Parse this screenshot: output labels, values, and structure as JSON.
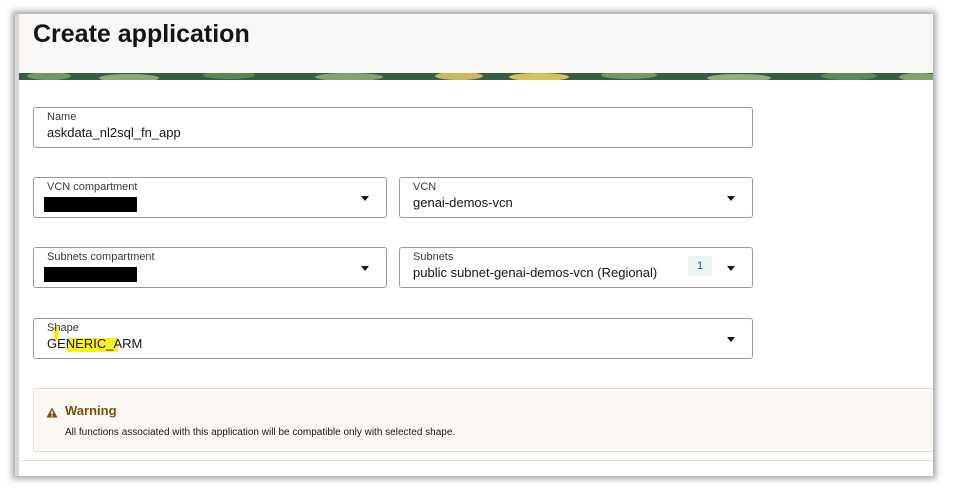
{
  "dialog": {
    "title": "Create application"
  },
  "form": {
    "name": {
      "label": "Name",
      "value": "askdata_nl2sql_fn_app"
    },
    "vcn_compartment": {
      "label": "VCN compartment",
      "value": ""
    },
    "vcn": {
      "label": "VCN",
      "value": "genai-demos-vcn"
    },
    "subnets_compartment": {
      "label": "Subnets compartment",
      "value": ""
    },
    "subnets": {
      "label": "Subnets",
      "value": "public subnet-genai-demos-vcn (Regional)",
      "count": "1"
    },
    "shape": {
      "label": "Shape",
      "value": "GENERIC_ARM"
    }
  },
  "warning": {
    "title": "Warning",
    "message": "All functions associated with this application will be compatible only with selected shape."
  },
  "icons": {
    "dropdown": "chevron-down-icon",
    "warning": "warning-triangle-icon"
  },
  "colors": {
    "highlight": "#f7ec00",
    "warning_title": "#7a4f0a",
    "warning_bg": "#fcf9f5"
  }
}
